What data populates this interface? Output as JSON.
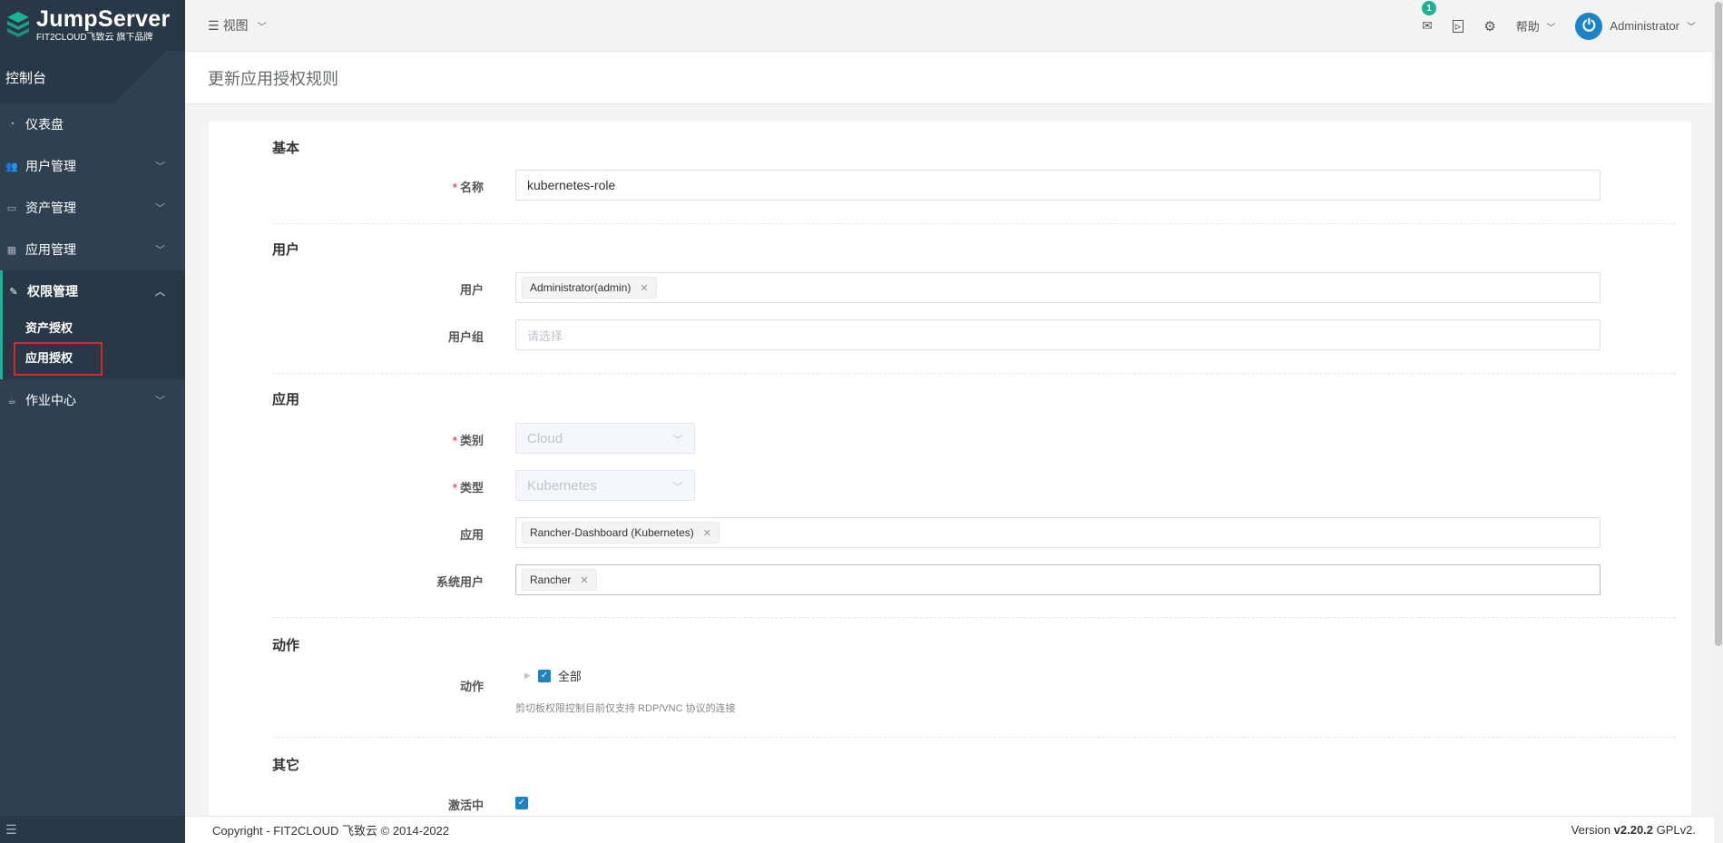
{
  "brand": {
    "title": "JumpServer",
    "subtitle": "FIT2CLOUD飞致云 旗下品牌"
  },
  "sidebar": {
    "console": "控制台",
    "items": [
      {
        "label": "仪表盘",
        "icon": "dashboard-icon"
      },
      {
        "label": "用户管理",
        "icon": "users-icon"
      },
      {
        "label": "资产管理",
        "icon": "inbox-icon"
      },
      {
        "label": "应用管理",
        "icon": "grid-icon"
      },
      {
        "label": "权限管理",
        "icon": "edit-icon"
      },
      {
        "label": "作业中心",
        "icon": "coffee-icon"
      }
    ],
    "perm_sub": [
      "资产授权",
      "应用授权"
    ]
  },
  "topbar": {
    "view_label": "视图",
    "notifications_count": "1",
    "help_label": "帮助",
    "user_name": "Administrator"
  },
  "page": {
    "title": "更新应用授权规则"
  },
  "form": {
    "sections": {
      "basic": "基本",
      "user": "用户",
      "app": "应用",
      "action": "动作",
      "other": "其它"
    },
    "name_label": "名称",
    "name_value": "kubernetes-role",
    "users_label": "用户",
    "users_tag": "Administrator(admin)",
    "usergroups_label": "用户组",
    "usergroups_placeholder": "请选择",
    "category_label": "类别",
    "category_value": "Cloud",
    "type_label": "类型",
    "type_value": "Kubernetes",
    "apps_label": "应用",
    "apps_tag": "Rancher-Dashboard (Kubernetes)",
    "sysusers_label": "系统用户",
    "sysusers_tag": "Rancher",
    "actions_label": "动作",
    "actions_all": "全部",
    "actions_hint": "剪切板权限控制目前仅支持 RDP/VNC 协议的连接",
    "active_label": "激活中"
  },
  "footer": {
    "copyright": "Copyright - FIT2CLOUD 飞致云 © 2014-2022",
    "version_prefix": "Version",
    "version": "v2.20.2",
    "license": "GPLv2."
  }
}
